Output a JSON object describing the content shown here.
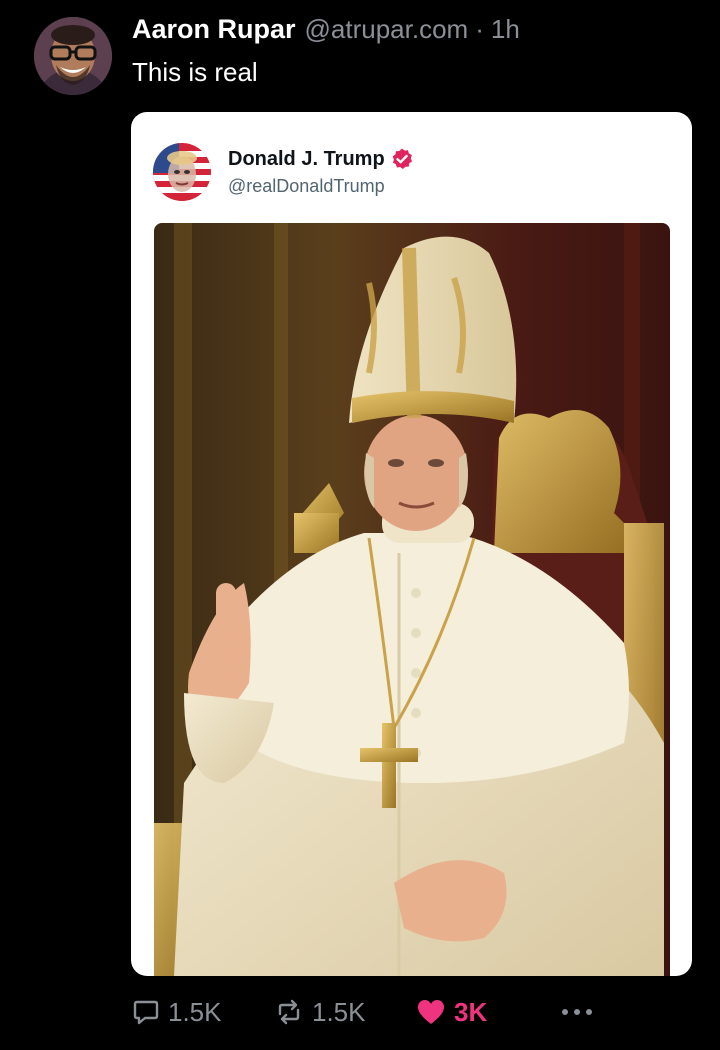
{
  "post": {
    "author_name": "Aaron Rupar",
    "author_handle": "@atrupar.com",
    "separator": "·",
    "time": "1h",
    "text": "This is real"
  },
  "quote": {
    "author_name": "Donald J. Trump",
    "author_handle": "@realDonaldTrump",
    "verified": true
  },
  "actions": {
    "replies": "1.5K",
    "reposts": "1.5K",
    "likes": "3K",
    "liked": true
  },
  "colors": {
    "background": "#000000",
    "primary_text": "#ffffff",
    "secondary_text": "#8b8f96",
    "card_background": "#ffffff",
    "like_accent": "#f0337e",
    "verified_badge": "#e0245e"
  },
  "icons": {
    "reply": "reply-bubble-icon",
    "repost": "repost-arrows-icon",
    "like": "heart-icon",
    "more": "more-dots-icon",
    "verified": "verified-badge-icon"
  }
}
